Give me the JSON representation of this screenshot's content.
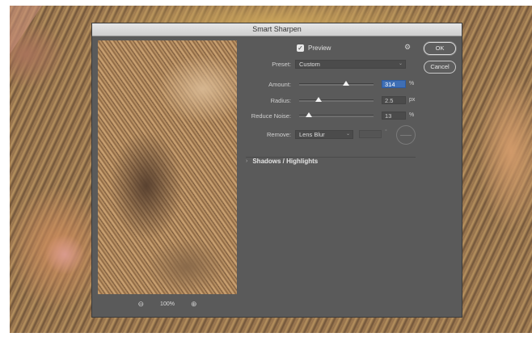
{
  "dialog": {
    "title": "Smart Sharpen",
    "preview_label": "Preview",
    "preview_checked": true,
    "preset_label": "Preset:",
    "preset_value": "Custom",
    "amount": {
      "label": "Amount:",
      "value": "314",
      "unit": "%",
      "level": 0.63
    },
    "radius": {
      "label": "Radius:",
      "value": "2.5",
      "unit": "px",
      "level": 0.26
    },
    "reduce_noise": {
      "label": "Reduce Noise:",
      "value": "13",
      "unit": "%",
      "level": 0.13
    },
    "remove_label": "Remove:",
    "remove_value": "Lens Blur",
    "angle_degree": "°",
    "section_label": "Shadows / Highlights",
    "ok_label": "OK",
    "cancel_label": "Cancel",
    "zoom_level": "100%"
  },
  "icons": {
    "gear": "gear-icon",
    "zoom_out": "zoom-out-icon",
    "zoom_in": "zoom-in-icon",
    "checkbox": "checkmark-icon"
  },
  "colors": {
    "dialog_bg": "#5a5a5a",
    "amount_field_highlight": "#3f6fb5"
  }
}
